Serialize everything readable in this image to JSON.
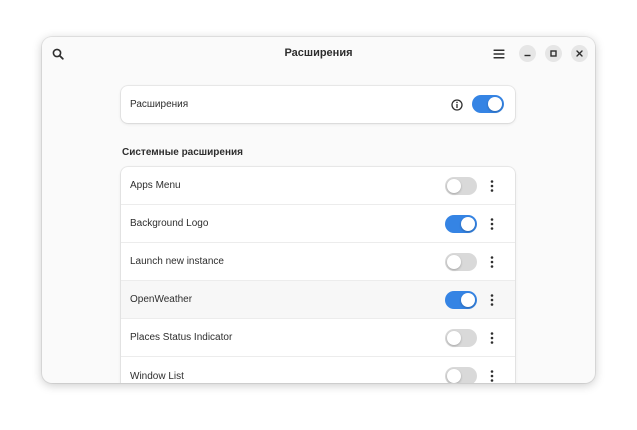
{
  "window": {
    "title": "Расширения"
  },
  "main_toggle": {
    "label": "Расширения",
    "enabled": true
  },
  "section": {
    "title": "Системные расширения"
  },
  "extensions": [
    {
      "label": "Apps Menu",
      "enabled": false
    },
    {
      "label": "Background Logo",
      "enabled": true
    },
    {
      "label": "Launch new instance",
      "enabled": false
    },
    {
      "label": "OpenWeather",
      "enabled": true
    },
    {
      "label": "Places Status Indicator",
      "enabled": false
    },
    {
      "label": "Window List",
      "enabled": false
    }
  ],
  "colors": {
    "accent": "#3584e4",
    "switch_off": "#d9d9d9"
  },
  "icons": {
    "search": "search-icon",
    "menu": "hamburger-menu-icon",
    "minimize": "minimize-icon",
    "maximize": "maximize-icon",
    "close": "close-icon",
    "info": "info-icon",
    "kebab": "vertical-ellipsis-icon"
  }
}
